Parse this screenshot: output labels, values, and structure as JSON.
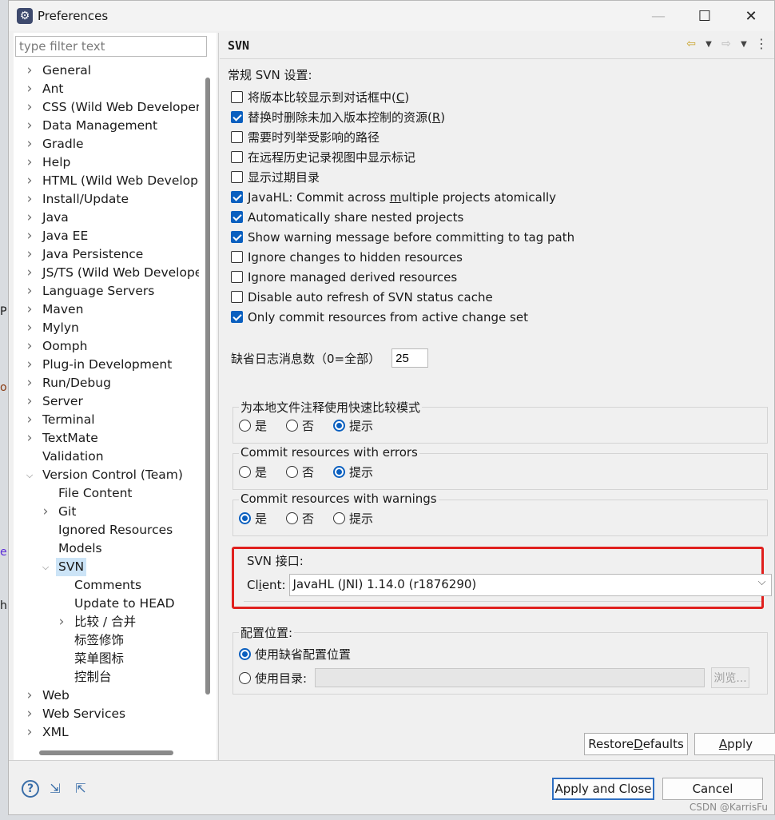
{
  "window": {
    "title": "Preferences"
  },
  "left_edge_letters": [
    "P",
    "o",
    "e",
    "h"
  ],
  "filter": {
    "placeholder": "type filter text"
  },
  "tree": [
    {
      "label": "General",
      "indent": 0,
      "arrow": "collapsed"
    },
    {
      "label": "Ant",
      "indent": 0,
      "arrow": "collapsed"
    },
    {
      "label": "CSS (Wild Web Developer)",
      "indent": 0,
      "arrow": "collapsed"
    },
    {
      "label": "Data Management",
      "indent": 0,
      "arrow": "collapsed"
    },
    {
      "label": "Gradle",
      "indent": 0,
      "arrow": "collapsed"
    },
    {
      "label": "Help",
      "indent": 0,
      "arrow": "collapsed"
    },
    {
      "label": "HTML (Wild Web Develope",
      "indent": 0,
      "arrow": "collapsed"
    },
    {
      "label": "Install/Update",
      "indent": 0,
      "arrow": "collapsed"
    },
    {
      "label": "Java",
      "indent": 0,
      "arrow": "collapsed"
    },
    {
      "label": "Java EE",
      "indent": 0,
      "arrow": "collapsed"
    },
    {
      "label": "Java Persistence",
      "indent": 0,
      "arrow": "collapsed"
    },
    {
      "label": "JS/TS (Wild Web Developer",
      "indent": 0,
      "arrow": "collapsed"
    },
    {
      "label": "Language Servers",
      "indent": 0,
      "arrow": "collapsed"
    },
    {
      "label": "Maven",
      "indent": 0,
      "arrow": "collapsed"
    },
    {
      "label": "Mylyn",
      "indent": 0,
      "arrow": "collapsed"
    },
    {
      "label": "Oomph",
      "indent": 0,
      "arrow": "collapsed"
    },
    {
      "label": "Plug-in Development",
      "indent": 0,
      "arrow": "collapsed"
    },
    {
      "label": "Run/Debug",
      "indent": 0,
      "arrow": "collapsed"
    },
    {
      "label": "Server",
      "indent": 0,
      "arrow": "collapsed"
    },
    {
      "label": "Terminal",
      "indent": 0,
      "arrow": "collapsed"
    },
    {
      "label": "TextMate",
      "indent": 0,
      "arrow": "collapsed"
    },
    {
      "label": "Validation",
      "indent": 0,
      "arrow": "none"
    },
    {
      "label": "Version Control (Team)",
      "indent": 0,
      "arrow": "expanded"
    },
    {
      "label": "File Content",
      "indent": 1,
      "arrow": "none"
    },
    {
      "label": "Git",
      "indent": 1,
      "arrow": "collapsed"
    },
    {
      "label": "Ignored Resources",
      "indent": 1,
      "arrow": "none"
    },
    {
      "label": "Models",
      "indent": 1,
      "arrow": "none"
    },
    {
      "label": "SVN",
      "indent": 1,
      "arrow": "expanded",
      "selected": true
    },
    {
      "label": "Comments",
      "indent": 2,
      "arrow": "none"
    },
    {
      "label": "Update to HEAD",
      "indent": 2,
      "arrow": "none"
    },
    {
      "label": "比较 / 合并",
      "indent": 2,
      "arrow": "collapsed"
    },
    {
      "label": "标签修饰",
      "indent": 2,
      "arrow": "none"
    },
    {
      "label": "菜单图标",
      "indent": 2,
      "arrow": "none"
    },
    {
      "label": "控制台",
      "indent": 2,
      "arrow": "none"
    },
    {
      "label": "Web",
      "indent": 0,
      "arrow": "collapsed"
    },
    {
      "label": "Web Services",
      "indent": 0,
      "arrow": "collapsed"
    },
    {
      "label": "XML",
      "indent": 0,
      "arrow": "collapsed"
    }
  ],
  "page": {
    "title": "SVN",
    "section_label": "常规 SVN 设置:",
    "checkboxes": [
      {
        "label": "将版本比较显示到对话框中(",
        "mnemonic": "C",
        "suffix": ")",
        "checked": false
      },
      {
        "label": "替换时删除未加入版本控制的资源(",
        "mnemonic": "R",
        "suffix": ")",
        "checked": true
      },
      {
        "label": "需要时列举受影响的路径",
        "checked": false
      },
      {
        "label": "在远程历史记录视图中显示标记",
        "checked": false
      },
      {
        "label": "显示过期目录",
        "checked": false
      },
      {
        "label": "JavaHL: Commit across ",
        "mnemonic": "m",
        "suffix": "ultiple projects atomically",
        "checked": true
      },
      {
        "label": "Automatically share nested projects",
        "checked": true
      },
      {
        "label": "Show warning message before committing to tag path",
        "checked": true
      },
      {
        "label": "Ignore changes to hidden resources",
        "checked": false
      },
      {
        "label": "Ignore managed derived resources",
        "checked": false
      },
      {
        "label": "Disable auto refresh of SVN status cache",
        "checked": false
      },
      {
        "label": "Only commit resources from active change set",
        "checked": true
      }
    ],
    "log_count": {
      "label": "缺省日志消息数（0=全部）",
      "value": "25"
    },
    "radio_groups": [
      {
        "title": "为本地文件注释使用快速比较模式",
        "options": [
          "是",
          "否",
          "提示"
        ],
        "selected": 2
      },
      {
        "title": "Commit resources with errors",
        "options": [
          "是",
          "否",
          "提示"
        ],
        "selected": 2
      },
      {
        "title": "Commit resources with warnings",
        "options": [
          "是",
          "否",
          "提示"
        ],
        "selected": 0
      }
    ],
    "svn_interface": {
      "title": "SVN 接口:",
      "client_label_pre": "Cl",
      "client_mnemonic": "i",
      "client_label_post": "ent:",
      "client_value": "JavaHL (JNI) 1.14.0 (r1876290)"
    },
    "config": {
      "title": "配置位置:",
      "option_default": "使用缺省配置位置",
      "option_dir": "使用目录:",
      "browse": "浏览...",
      "selected": "default"
    },
    "restore_defaults": {
      "pre": "Restore ",
      "mn": "D",
      "post": "efaults"
    },
    "apply": {
      "pre": "",
      "mn": "A",
      "post": "pply"
    }
  },
  "footer": {
    "apply_close": "Apply and Close",
    "cancel": "Cancel",
    "watermark": "CSDN @KarrisFu"
  },
  "colors": {
    "accent": "#0a5fbf",
    "highlight_box": "#e0201e",
    "selection": "#cce4f7"
  }
}
